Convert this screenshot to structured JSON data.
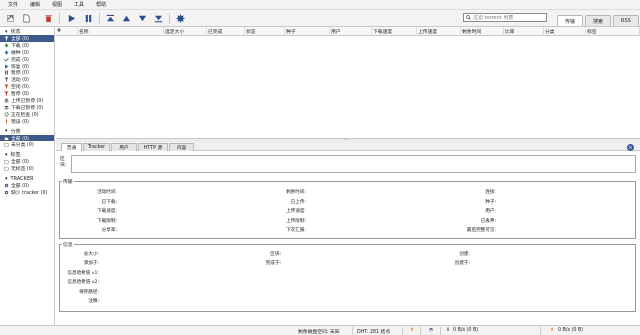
{
  "menu": [
    "文件",
    "编辑",
    "视图",
    "工具",
    "帮助"
  ],
  "search": {
    "placeholder": "过滤 torrent 列表"
  },
  "right_tabs": {
    "transfers": "传输",
    "search": "搜索",
    "rss": "RSS"
  },
  "sidebar": {
    "status": {
      "header": "状态",
      "items": [
        {
          "label": "全部 (0)",
          "icon": "all-filter-icon",
          "color": "#c0392b"
        },
        {
          "label": "下载 (0)",
          "icon": "download-arrow-icon",
          "color": "#2e7d32"
        },
        {
          "label": "做种 (0)",
          "icon": "upload-arrow-icon",
          "color": "#1565c0"
        },
        {
          "label": "完成 (0)",
          "icon": "check-icon",
          "color": "#2e7d32"
        },
        {
          "label": "恢复 (0)",
          "icon": "play-icon",
          "color": "#1565c0"
        },
        {
          "label": "暂停 (0)",
          "icon": "pause-icon",
          "color": "#c0392b"
        },
        {
          "label": "活动 (0)",
          "icon": "filter-icon",
          "color": "#555555"
        },
        {
          "label": "空闲 (0)",
          "icon": "filter-icon",
          "color": "#c0392b"
        },
        {
          "label": "暂停 (0)",
          "icon": "filter-icon",
          "color": "#c0392b"
        },
        {
          "label": "上传已暂停 (0)",
          "icon": "stalled-upload-icon",
          "color": "#333333"
        },
        {
          "label": "下载已暂停 (0)",
          "icon": "stalled-download-icon",
          "color": "#333333"
        },
        {
          "label": "正在检查 (0)",
          "icon": "refresh-icon",
          "color": "#2e7d32"
        },
        {
          "label": "错误 (0)",
          "icon": "error-icon",
          "color": "#c0392b"
        }
      ]
    },
    "categories": {
      "header": "分类",
      "items": [
        {
          "label": "全部 (0)",
          "icon": "folder-icon"
        },
        {
          "label": "未分类 (0)",
          "icon": "folder-icon"
        }
      ]
    },
    "tags": {
      "header": "标签",
      "items": [
        {
          "label": "全部 (0)",
          "icon": "tag-icon"
        },
        {
          "label": "无标签 (0)",
          "icon": "tag-icon"
        }
      ]
    },
    "trackers": {
      "header": "TRACKER",
      "items": [
        {
          "label": "全部 (0)",
          "icon": "tracker-icon"
        },
        {
          "label": "缺少 tracker (0)",
          "icon": "tracker-icon"
        }
      ]
    }
  },
  "columns": [
    "#",
    "名称",
    "选定大小",
    "已完成",
    "状态",
    "种子",
    "用户",
    "下载速度",
    "上传速度",
    "剩余时间",
    "比率",
    "分类",
    "标签"
  ],
  "detail_tabs": [
    "普通",
    "Tracker",
    "用户",
    "HTTP 源",
    "内容"
  ],
  "detail": {
    "tracker_label": "区块:",
    "transfer": {
      "legend": "传输",
      "col1": [
        "活动时间:",
        "已下载:",
        "下载速度:",
        "下载限制:",
        "分享率:"
      ],
      "col2": [
        "剩余时间:",
        "已上传:",
        "上传速度:",
        "上传限制:",
        "下次汇报:"
      ],
      "col3": [
        "连接:",
        "种子:",
        "用户:",
        "已丢弃:",
        "最后完整可见:"
      ]
    },
    "info": {
      "legend": "信息",
      "col1": [
        "总大小:",
        "添加于:",
        "信息哈希值 v1:",
        "信息哈希值 v2:",
        "保存路径:",
        "注释:"
      ],
      "col2": [
        "区块:",
        "完成于:"
      ],
      "col3": [
        "创建:",
        "创建于:"
      ]
    }
  },
  "status": {
    "free_space": "剩余磁盘空间: 未知",
    "dht": "DHT: 281 结点",
    "download": "0 B/s (0 B)",
    "upload": "0 B/s (0 B)"
  }
}
